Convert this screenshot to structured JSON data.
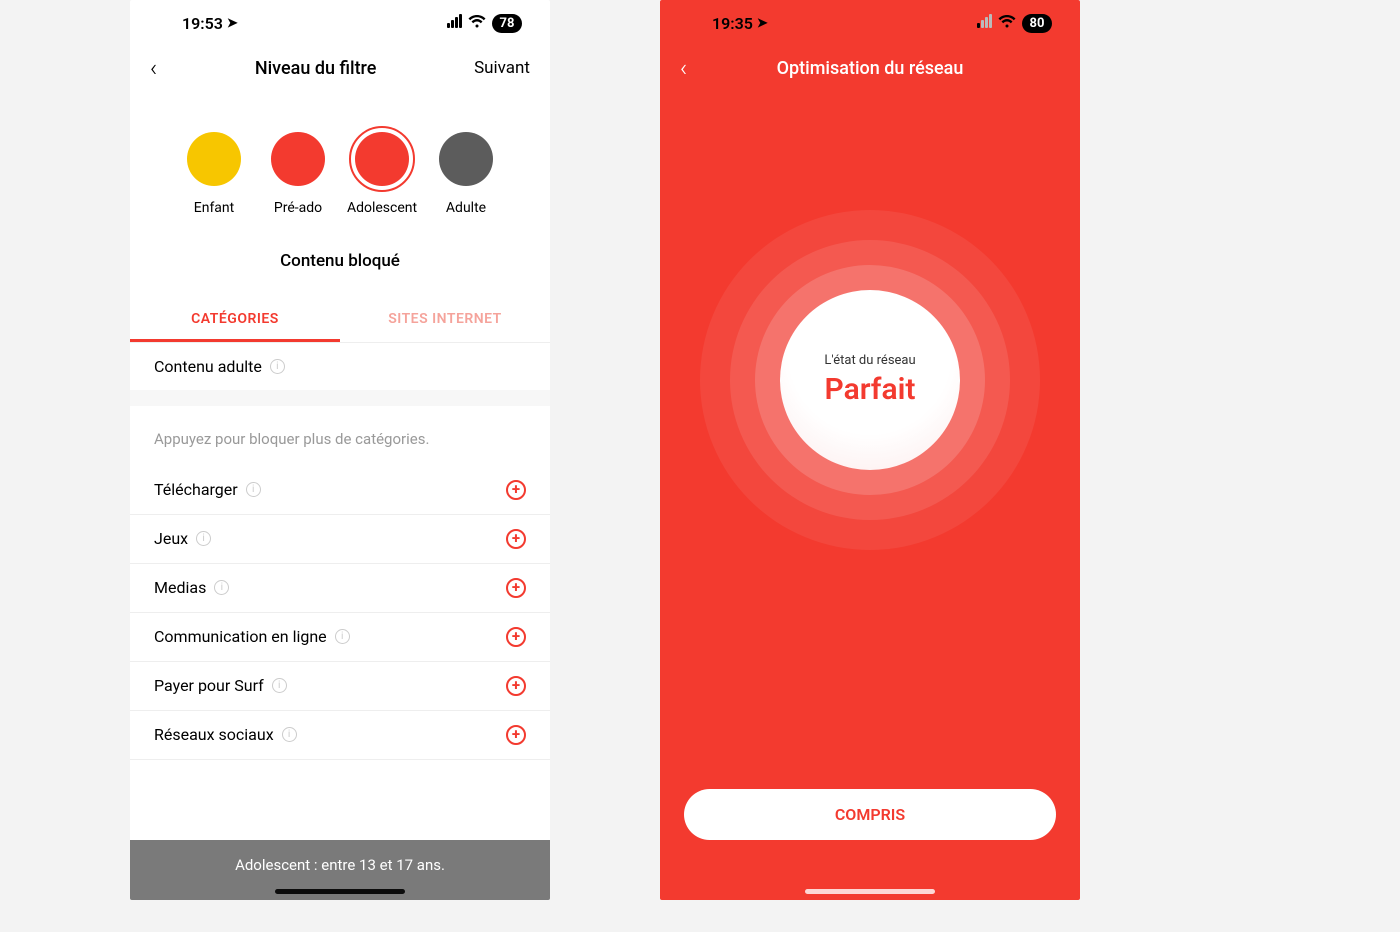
{
  "left": {
    "status": {
      "time": "19:53",
      "battery": "78"
    },
    "nav": {
      "title": "Niveau du filtre",
      "next": "Suivant"
    },
    "levels": [
      {
        "label": "Enfant",
        "color": "#f7c600",
        "selected": false
      },
      {
        "label": "Pré-ado",
        "color": "#f33a2f",
        "selected": false
      },
      {
        "label": "Adolescent",
        "color": "#f33a2f",
        "selected": true
      },
      {
        "label": "Adulte",
        "color": "#5c5c5c",
        "selected": false
      }
    ],
    "section_title": "Contenu bloqué",
    "tabs": {
      "categories": "CATÉGORIES",
      "sites": "SITES INTERNET",
      "active": "categories"
    },
    "blocked": [
      "Contenu adulte"
    ],
    "hint": "Appuyez pour bloquer plus de catégories.",
    "available": [
      "Télécharger",
      "Jeux",
      "Medias",
      "Communication en ligne",
      "Payer pour Surf",
      "Réseaux sociaux"
    ],
    "toast": "Adolescent : entre 13 et 17 ans."
  },
  "right": {
    "status": {
      "time": "19:35",
      "battery": "80"
    },
    "nav": {
      "title": "Optimisation du réseau"
    },
    "core": {
      "label": "L'état du réseau",
      "value": "Parfait"
    },
    "cta": "COMPRIS"
  }
}
